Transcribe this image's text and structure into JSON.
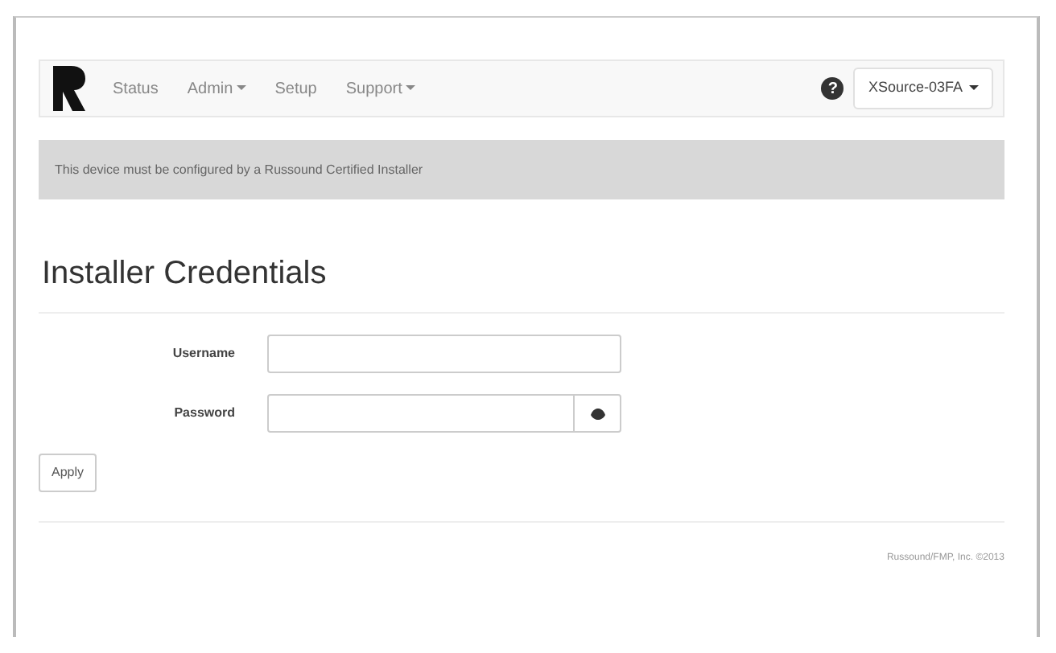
{
  "navbar": {
    "items": [
      {
        "label": "Status",
        "dropdown": false
      },
      {
        "label": "Admin",
        "dropdown": true
      },
      {
        "label": "Setup",
        "dropdown": false
      },
      {
        "label": "Support",
        "dropdown": true
      }
    ],
    "help": "?",
    "device_button": "XSource-03FA"
  },
  "alert": "This device must be configured by a Russound Certified Installer",
  "heading": "Installer Credentials",
  "form": {
    "fields": [
      {
        "label": "Username",
        "kind": "text"
      },
      {
        "label": "Password",
        "kind": "password"
      }
    ],
    "apply": "Apply"
  },
  "footer": "Russound/FMP, Inc. ©2013"
}
